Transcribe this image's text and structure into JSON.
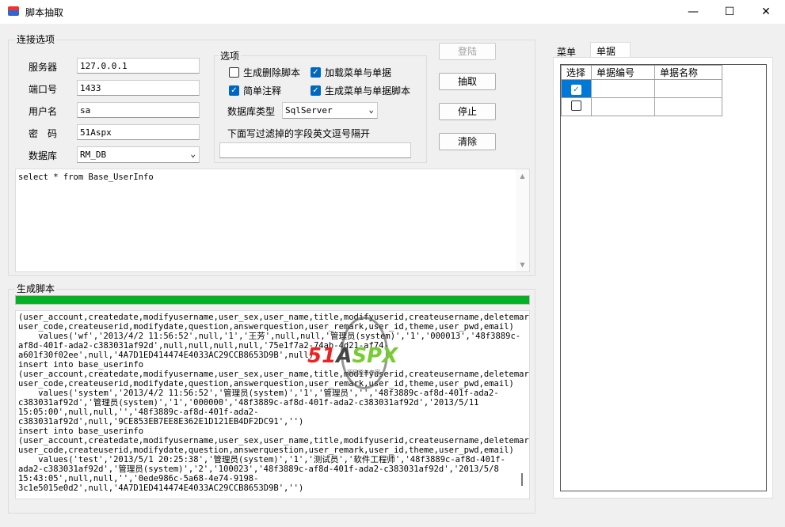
{
  "window": {
    "title": "脚本抽取"
  },
  "conn": {
    "group_label": "连接选项",
    "server_label": "服务器",
    "server": "127.0.0.1",
    "port_label": "端口号",
    "port": "1433",
    "user_label": "用户名",
    "user": "sa",
    "pwd_label": "密　码",
    "pwd": "51Aspx",
    "db_label": "数据库",
    "db": "RM_DB"
  },
  "options": {
    "group_label": "选项",
    "gen_delete": "生成删除脚本",
    "load_menu": "加载菜单与单据",
    "simple_comment": "简单注释",
    "gen_menu_script": "生成菜单与单据脚本",
    "dbtype_label": "数据库类型",
    "dbtype": "SqlServer",
    "filter_label": "下面写过滤掉的字段英文逗号隔开",
    "filter_value": ""
  },
  "buttons": {
    "login": "登陆",
    "extract": "抽取",
    "stop": "停止",
    "clear": "清除"
  },
  "sql": "select * from Base_UserInfo",
  "output": {
    "group_label": "生成脚本",
    "progress": 100,
    "lines": [
      "(user_account,createdate,modifyusername,user_sex,user_name,title,modifyuserid,createusername,deletemark,",
      "user_code,createuserid,modifydate,question,answerquestion,user_remark,user_id,theme,user_pwd,email)",
      "    values('wf','2013/4/2 11:56:52',null,'1','王芳',null,null,'管理员(system)','1','000013','48f3889c-",
      "af8d-401f-ada2-c383031af92d',null,null,null,null,'75e1f7a2-74ab-4d21-af74-",
      "a601f30f02ee',null,'4A7D1ED414474E4033AC29CCB8653D9B',null)",
      "insert into base_userinfo",
      "(user_account,createdate,modifyusername,user_sex,user_name,title,modifyuserid,createusername,deletemark,",
      "user_code,createuserid,modifydate,question,answerquestion,user_remark,user_id,theme,user_pwd,email)",
      "    values('system','2013/4/2 11:56:52','管理员(system)','1','管理员','','48f3889c-af8d-401f-ada2-",
      "c383031af92d','管理员(system)','1','000000','48f3889c-af8d-401f-ada2-c383031af92d','2013/5/11",
      "15:05:00',null,null,'','48f3889c-af8d-401f-ada2-",
      "c383031af92d',null,'9CE853EB7EE8E362E1D121EB4DF2DC91','')",
      "insert into base_userinfo",
      "(user_account,createdate,modifyusername,user_sex,user_name,title,modifyuserid,createusername,deletemark,",
      "user_code,createuserid,modifydate,question,answerquestion,user_remark,user_id,theme,user_pwd,email)",
      "    values('test','2013/5/1 20:25:38','管理员(system)','1','测试员','软件工程师','48f3889c-af8d-401f-",
      "ada2-c383031af92d','管理员(system)','2','100023','48f3889c-af8d-401f-ada2-c383031af92d','2013/5/8",
      "15:43:05',null,null,'','0ede986c-5a68-4e74-9198-",
      "3c1e5015e0d2',null,'4A7D1ED414474E4033AC29CCB8653D9B','')"
    ]
  },
  "watermark": {
    "brand": "51Aspx",
    "tagline": "源码服务专家"
  },
  "right": {
    "tabs": [
      "菜单",
      "单据"
    ],
    "active_tab": 1,
    "columns": [
      "选择",
      "单据编号",
      "单据名称"
    ],
    "rows": [
      {
        "checked": true,
        "code": "",
        "name": ""
      },
      {
        "checked": false,
        "code": "",
        "name": ""
      }
    ]
  },
  "colors": {
    "progress": "#06b025",
    "accent": "#0067c0"
  }
}
